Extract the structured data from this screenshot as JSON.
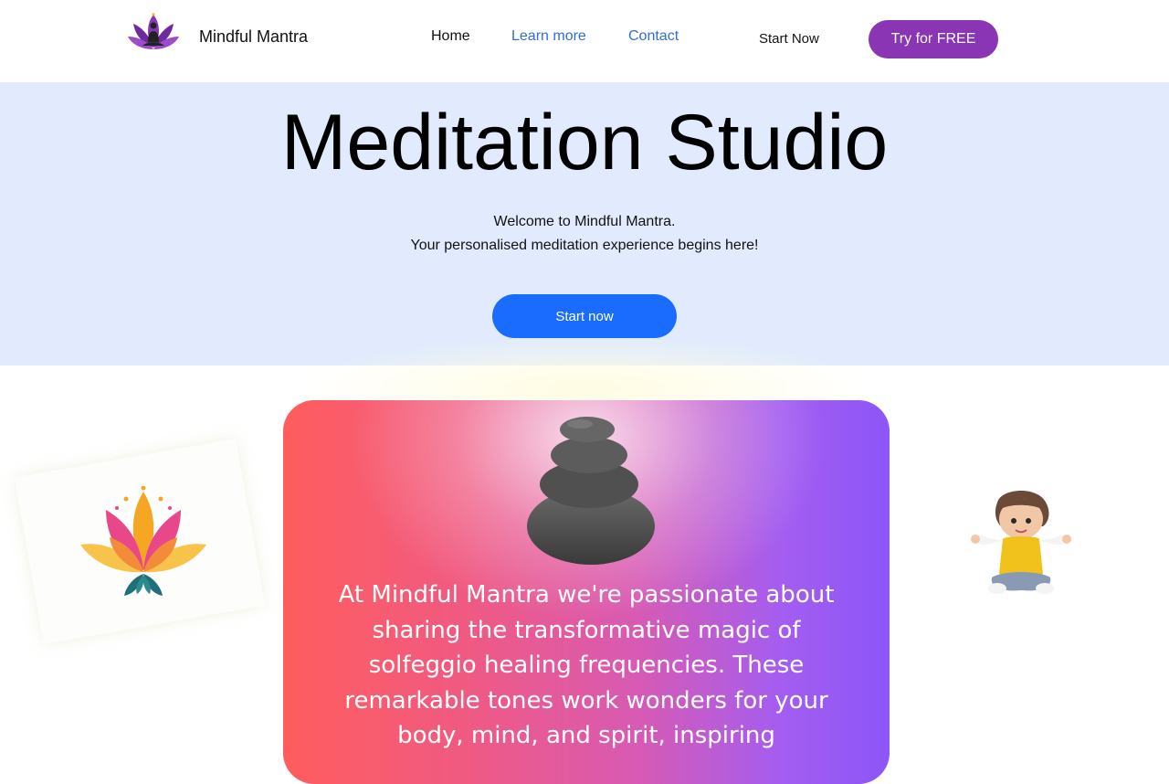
{
  "header": {
    "brand": "Mindful Mantra",
    "nav": {
      "home": "Home",
      "learn_more": "Learn more",
      "contact": "Contact",
      "start_now": "Start Now"
    },
    "cta": "Try for FREE"
  },
  "hero": {
    "title": "Meditation Studio",
    "welcome": "Welcome to  Mindful Mantra.",
    "subtitle": "Your personalised meditation experience begins here!",
    "button": "Start now"
  },
  "card": {
    "text": "At Mindful Mantra we're passionate about sharing the transformative magic of solfeggio healing frequencies. These remarkable tones work wonders for your body, mind, and spirit, inspiring"
  },
  "icons": {
    "logo": "lotus-meditation-logo-icon",
    "stones": "stacked-stones-icon",
    "lotus": "lotus-flower-icon",
    "figure": "meditating-boy-icon"
  },
  "colors": {
    "brand_purple": "#8a35b4",
    "hero_bg": "#e1ebfd",
    "primary_blue": "#1a6cff",
    "link_blue": "#2f6fd6"
  }
}
